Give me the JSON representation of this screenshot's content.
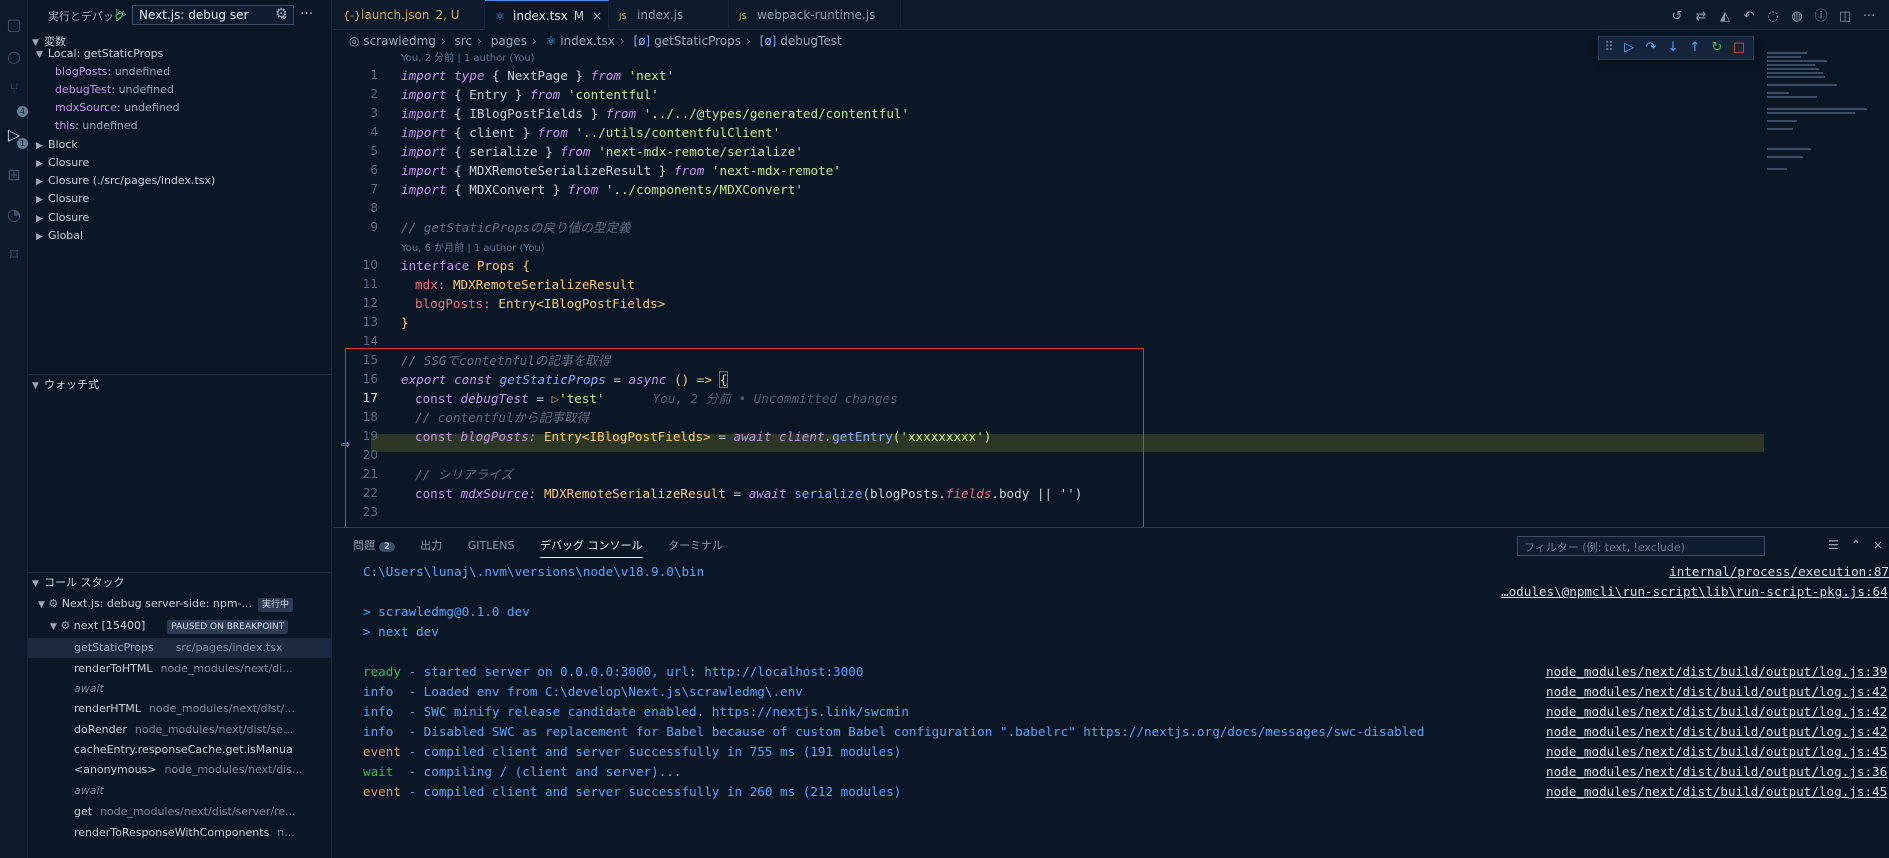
{
  "sidebar": {
    "title": "実行とデバッグ",
    "launch_config": "Next.js: debug ser",
    "variables_header": "変数",
    "local_scope": "Local: getStaticProps",
    "variables": [
      {
        "name": "blogPosts",
        "value": "undefined"
      },
      {
        "name": "debugTest",
        "value": "undefined"
      },
      {
        "name": "mdxSource",
        "value": "undefined"
      },
      {
        "name": "this",
        "value": "undefined"
      }
    ],
    "scopes": [
      "Block",
      "Closure",
      "Closure (./src/pages/index.tsx)",
      "Closure",
      "Closure",
      "Global"
    ],
    "watch_header": "ウォッチ式",
    "callstack_header": "コール スタック",
    "session": {
      "name": "Next.js: debug server-side: npm-...",
      "status": "実行中"
    },
    "thread": {
      "name": "next [15400]",
      "status": "PAUSED ON BREAKPOINT"
    },
    "frames": [
      {
        "fn": "getStaticProps",
        "path": "src/pages/index.tsx"
      },
      {
        "fn": "renderToHTML",
        "path": "node_modules/next/di..."
      },
      {
        "fn": "await",
        "path": ""
      },
      {
        "fn": "renderHTML",
        "path": "node_modules/next/dist/..."
      },
      {
        "fn": "doRender",
        "path": "node_modules/next/dist/se..."
      },
      {
        "fn": "cacheEntry.responseCache.get.isManua",
        "path": ""
      },
      {
        "fn": "<anonymous>",
        "path": "node_modules/next/dis..."
      },
      {
        "fn": "await",
        "path": ""
      },
      {
        "fn": "get",
        "path": "node_modules/next/dist/server/re..."
      },
      {
        "fn": "renderToResponseWithComponents",
        "path": "n..."
      }
    ],
    "activity_badges": [
      "4",
      "1"
    ]
  },
  "tabs": [
    {
      "label": "launch.json",
      "suffix": "2, U",
      "icon": "{-}"
    },
    {
      "label": "index.tsx",
      "suffix": "M",
      "icon": "⚛"
    },
    {
      "label": "index.js",
      "suffix": "",
      "icon": "JS"
    },
    {
      "label": "webpack-runtime.js",
      "suffix": "",
      "icon": "JS"
    }
  ],
  "breadcrumb": [
    "scrawledmg",
    "src",
    "pages",
    "index.tsx",
    "getStaticProps",
    "debugTest"
  ],
  "blame": {
    "top": "You, 2 分前 | 1 author (You)",
    "mid": "You, 6 か月前 | 1 author (You)",
    "inline": "You, 2 分前 • Uncommitted changes"
  },
  "code": {
    "line_numbers": [
      "1",
      "2",
      "3",
      "4",
      "5",
      "6",
      "7",
      "8",
      "9",
      "10",
      "11",
      "12",
      "13",
      "14",
      "15",
      "16",
      "17",
      "18",
      "19",
      "20",
      "21",
      "22",
      "23"
    ],
    "l1": {
      "a": "import",
      "b": "type",
      "c": "{ NextPage }",
      "d": "from",
      "e": "'next'"
    },
    "l2": {
      "a": "import",
      "c": "{ Entry }",
      "d": "from",
      "e": "'contentful'"
    },
    "l3": {
      "a": "import",
      "c": "{ IBlogPostFields }",
      "d": "from",
      "e": "'../../@types/generated/contentful'"
    },
    "l4": {
      "a": "import",
      "c": "{ client }",
      "d": "from",
      "e": "'../utils/contentfulClient'"
    },
    "l5": {
      "a": "import",
      "c": "{ serialize }",
      "d": "from",
      "e": "'next-mdx-remote/serialize'"
    },
    "l6": {
      "a": "import",
      "c": "{ MDXRemoteSerializeResult }",
      "d": "from",
      "e": "'next-mdx-remote'"
    },
    "l7": {
      "a": "import",
      "c": "{ MDXConvert }",
      "d": "from",
      "e": "'../components/MDXConvert'"
    },
    "l9": "// getStaticPropsの戻り値の型定義",
    "l10": {
      "a": "interface",
      "b": "Props",
      "c": "{"
    },
    "l11": {
      "a": "mdx:",
      "b": "MDXRemoteSerializeResult"
    },
    "l12": {
      "a": "blogPosts:",
      "b": "Entry",
      "c": "<IBlogPostFields>"
    },
    "l13": "}",
    "l15": "// SSGでcontetnfulの記事を取得",
    "l16": {
      "a": "export",
      "b": "const",
      "c": "getStaticProps",
      "d": "=",
      "e": "async",
      "f": "() =>",
      "g": "{"
    },
    "l17": {
      "a": "const",
      "b": "debugTest",
      "c": "=",
      "d": "'test'"
    },
    "l18": "// contentfulから記事取得",
    "l19": {
      "a": "const",
      "b": "blogPosts:",
      "c": "Entry<IBlogPostFields>",
      "d": "=",
      "e": "await",
      "f": "client.",
      "g": "getEntry",
      "h": "('xxxxxxxxx')"
    },
    "l21": "// シリアライズ",
    "l22": {
      "a": "const",
      "b": "mdxSource:",
      "c": "MDXRemoteSerializeResult",
      "d": "=",
      "e": "await",
      "f": "serialize",
      "g": "(blogPosts.",
      "h": "fields",
      "i": ".body || '')"
    }
  },
  "panel": {
    "tabs": [
      "問題",
      "出力",
      "GITLENS",
      "デバッグ コンソール",
      "ターミナル"
    ],
    "problems_count": "2",
    "filter_placeholder": "フィルター (例: text, !exclude)",
    "lines": [
      {
        "text": "C:\\Users\\lunaj\\.nvm\\versions\\node\\v18.9.0\\bin",
        "src": "internal/process/execution:87"
      },
      {
        "text": "",
        "src": "…odules\\@npmcli\\run-script\\lib\\run-script-pkg.js:64"
      },
      {
        "text": "> scrawledmg@0.1.0 dev",
        "src": ""
      },
      {
        "text": "> next dev",
        "src": ""
      },
      {
        "text": "",
        "src": ""
      },
      {
        "level": "ready",
        "text": " - started server on 0.0.0.0:3000, url: http://localhost:3000",
        "src": "node_modules/next/dist/build/output/log.js:39"
      },
      {
        "level": "info ",
        "text": " - Loaded env from C:\\develop\\Next.js\\scrawledmg\\.env",
        "src": "node_modules/next/dist/build/output/log.js:42"
      },
      {
        "level": "info ",
        "text": " - SWC minify release candidate enabled. https://nextjs.link/swcmin",
        "src": "node_modules/next/dist/build/output/log.js:42"
      },
      {
        "level": "info ",
        "text": " - Disabled SWC as replacement for Babel because of custom Babel configuration \".babelrc\" https://nextjs.org/docs/messages/swc-disabled",
        "src": "node_modules/next/dist/build/output/log.js:42"
      },
      {
        "level": "event",
        "text": " - compiled client and server successfully in 755 ms (191 modules)",
        "src": "node_modules/next/dist/build/output/log.js:45"
      },
      {
        "level": "wait ",
        "text": " - compiling / (client and server)...",
        "src": "node_modules/next/dist/build/output/log.js:36"
      },
      {
        "level": "event",
        "text": " - compiled client and server successfully in 260 ms (212 modules)",
        "src": "node_modules/next/dist/build/output/log.js:45"
      }
    ]
  },
  "colors": {
    "accent": "#4d8ae0",
    "breakpoint": "#d7a24f",
    "highlight_box": "#e0333a"
  }
}
